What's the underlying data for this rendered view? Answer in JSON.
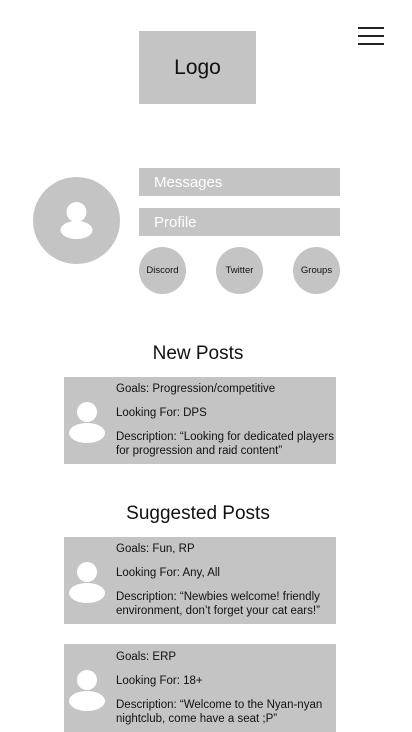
{
  "header": {
    "logo_text": "Logo",
    "menu_icon": "hamburger-menu-icon"
  },
  "profile": {
    "avatar_icon": "user-avatar-icon",
    "buttons": [
      "Messages",
      "Profile"
    ],
    "social": [
      "Discord",
      "Twitter",
      "Groups"
    ]
  },
  "new_posts": {
    "title": "New Posts",
    "items": [
      {
        "goals": "Goals: Progression/competitive",
        "looking": "Looking For: DPS",
        "description": "Description: “Looking for dedicated players for progression and raid content”"
      }
    ]
  },
  "suggested_posts": {
    "title": "Suggested Posts",
    "items": [
      {
        "goals": "Goals: Fun, RP",
        "looking": "Looking For: Any, All",
        "description": "Description: “Newbies welcome! friendly environment, don’t forget your cat ears!”"
      },
      {
        "goals": "Goals: ERP",
        "looking": "Looking For: 18+",
        "description": "Description: “Welcome to the Nyan-nyan nightclub, come have a seat ;P”"
      }
    ]
  },
  "colors": {
    "placeholder_gray": "#c4c4c4",
    "text": "#111111",
    "button_text": "#ffffff"
  }
}
